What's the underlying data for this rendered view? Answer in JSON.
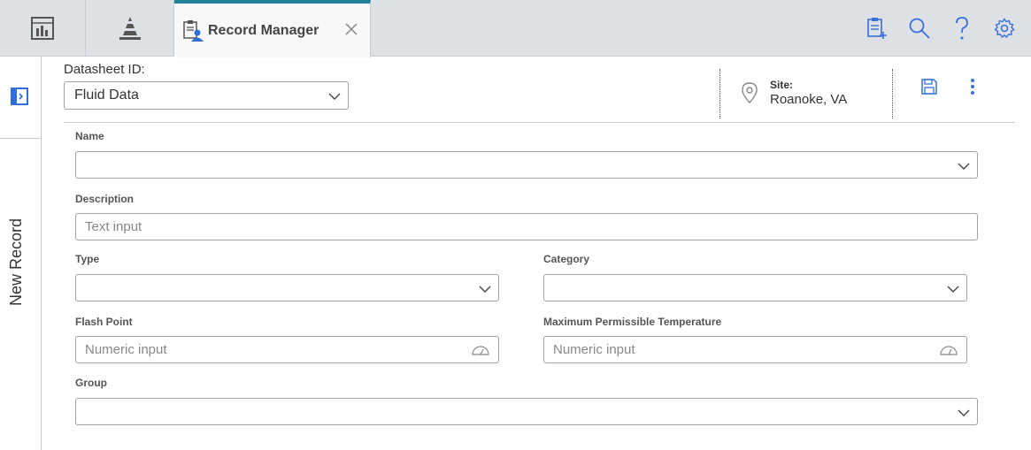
{
  "tabs": {
    "active_label": "Record Manager"
  },
  "icons": {
    "dashboard": "dashboard-icon",
    "asset_hierarchy": "pyramid-icon",
    "record_manager": "record-manager-icon",
    "close": "close-icon",
    "new_record_list": "add-list-icon",
    "search": "search-icon",
    "help": "help-icon",
    "settings": "gear-icon"
  },
  "sidebar": {
    "label": "New Record"
  },
  "header": {
    "datasheet_label": "Datasheet ID:",
    "datasheet_value": "Fluid Data",
    "site_label": "Site:",
    "site_value": "Roanoke, VA"
  },
  "form": {
    "name_label": "Name",
    "name_value": "",
    "description_label": "Description",
    "description_placeholder": "Text input",
    "type_label": "Type",
    "type_value": "",
    "category_label": "Category",
    "category_value": "",
    "flash_point_label": "Flash Point",
    "flash_point_placeholder": "Numeric input",
    "max_temp_label": "Maximum Permissible Temperature",
    "max_temp_placeholder": "Numeric input",
    "group_label": "Group",
    "group_value": ""
  },
  "colors": {
    "accent": "#1d8296",
    "icon_blue": "#3a6fd8",
    "topbar": "#dde1e6"
  }
}
